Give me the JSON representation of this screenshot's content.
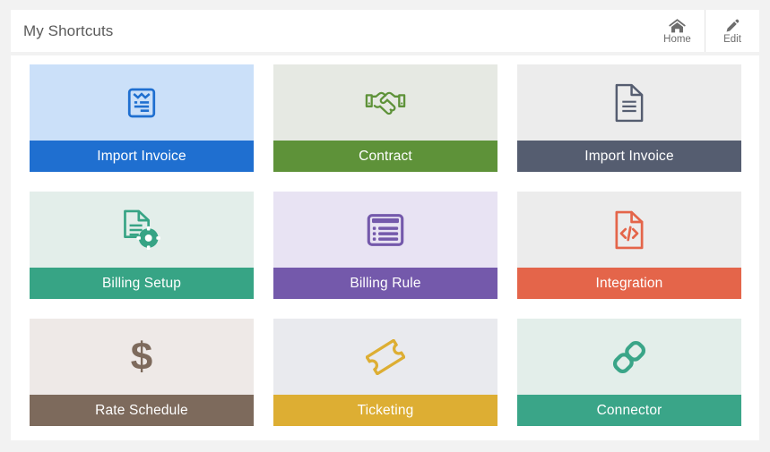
{
  "page": {
    "background": "#f2f2f2",
    "card_background": "#ffffff"
  },
  "header": {
    "title": "My Shortcuts",
    "actions": [
      {
        "label": "Home",
        "icon": "home-icon"
      },
      {
        "label": "Edit",
        "icon": "pencil-icon"
      }
    ]
  },
  "shortcuts": {
    "tiles": [
      {
        "label": "Import Invoice",
        "icon": "file-invoice-icon",
        "body_color": "#cbe0f9",
        "footer_color": "#1f6fd0",
        "icon_color": "#1f6fd0"
      },
      {
        "label": "Contract",
        "icon": "handshake-icon",
        "body_color": "#e6e9e3",
        "footer_color": "#5e9239",
        "icon_color": "#5e9239"
      },
      {
        "label": "Import Invoice",
        "icon": "file-lines-icon",
        "body_color": "#ececec",
        "footer_color": "#555d70",
        "icon_color": "#555d70"
      },
      {
        "label": "Billing Setup",
        "icon": "file-gear-icon",
        "body_color": "#e3eeea",
        "footer_color": "#37a485",
        "icon_color": "#37a485"
      },
      {
        "label": "Billing Rule",
        "icon": "list-table-icon",
        "body_color": "#e8e3f3",
        "footer_color": "#7459ab",
        "icon_color": "#7459ab"
      },
      {
        "label": "Integration",
        "icon": "file-code-icon",
        "body_color": "#ececec",
        "footer_color": "#e4654a",
        "icon_color": "#e4654a"
      },
      {
        "label": "Rate Schedule",
        "icon": "dollar-sign-icon",
        "body_color": "#eee9e7",
        "footer_color": "#7d6a5c",
        "icon_color": "#7d6a5c"
      },
      {
        "label": "Ticketing",
        "icon": "ticket-icon",
        "body_color": "#e9eaee",
        "footer_color": "#ddae33",
        "icon_color": "#ddae33"
      },
      {
        "label": "Connector",
        "icon": "link-chain-icon",
        "body_color": "#e3eeea",
        "footer_color": "#3aa588",
        "icon_color": "#3aa588"
      }
    ]
  }
}
